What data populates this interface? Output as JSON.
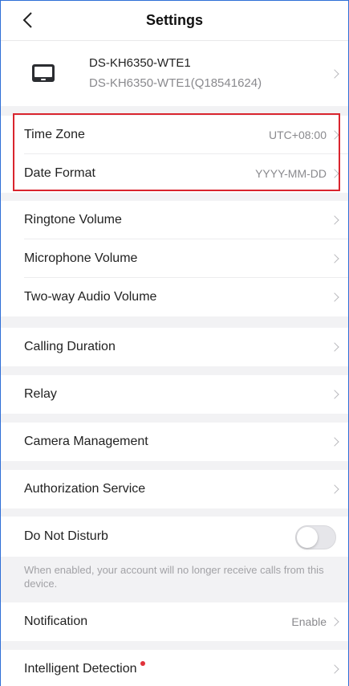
{
  "header": {
    "title": "Settings"
  },
  "device": {
    "name": "DS-KH6350-WTE1",
    "serial": "DS-KH6350-WTE1(Q18541624)"
  },
  "time_group": {
    "time_zone": {
      "label": "Time Zone",
      "value": "UTC+08:00"
    },
    "date_format": {
      "label": "Date Format",
      "value": "YYYY-MM-DD"
    }
  },
  "volume_group": {
    "ringtone": "Ringtone Volume",
    "microphone": "Microphone Volume",
    "two_way": "Two-way Audio Volume"
  },
  "calling_duration": "Calling Duration",
  "relay": "Relay",
  "camera_management": "Camera Management",
  "authorization_service": "Authorization Service",
  "dnd": {
    "label": "Do Not Disturb",
    "enabled": false,
    "note": "When enabled, your account will no longer receive calls from this device."
  },
  "notification": {
    "label": "Notification",
    "value": "Enable"
  },
  "intelligent_detection": {
    "label": "Intelligent Detection"
  },
  "colors": {
    "accent_green": "#7ab33a",
    "highlight_red": "#d9252e",
    "badge_red": "#e0323a"
  }
}
